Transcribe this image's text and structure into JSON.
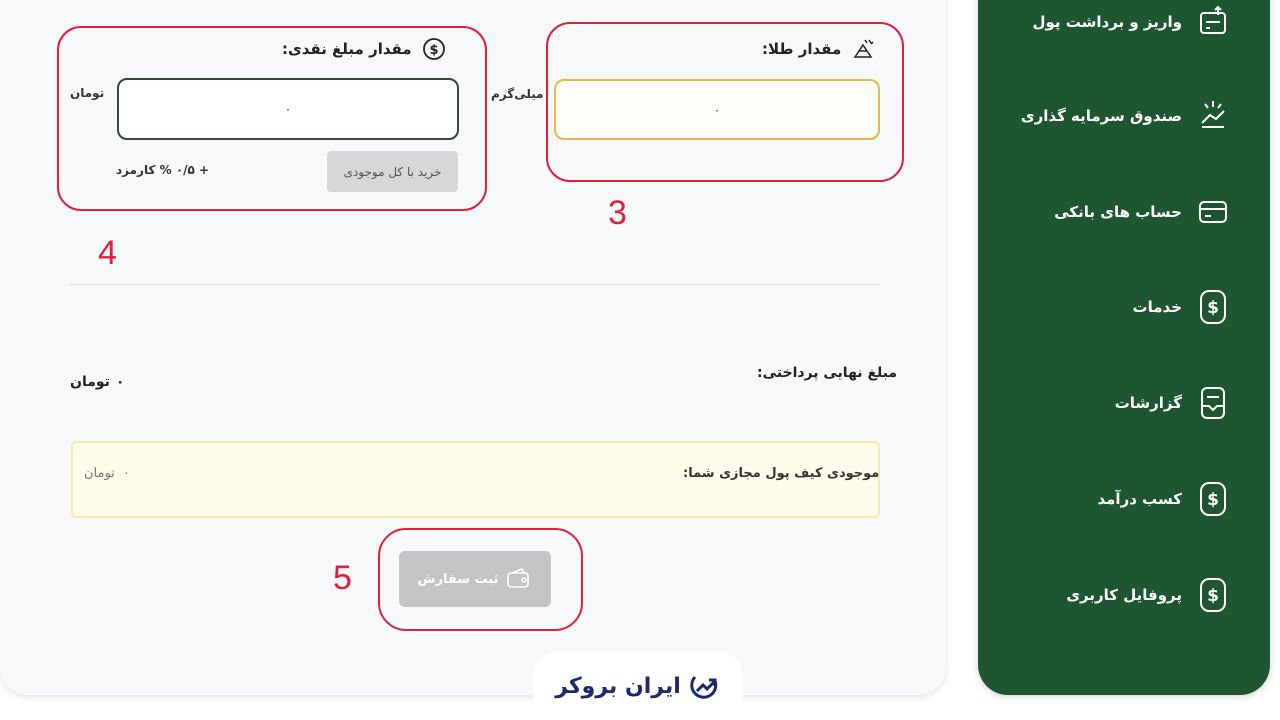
{
  "sidebar": {
    "items": [
      {
        "label": "واریز و برداشت پول",
        "icon": "wallet-transfer-icon"
      },
      {
        "label": "صندوق سرمایه گذاری",
        "icon": "investment-fund-icon"
      },
      {
        "label": "حساب های بانکی",
        "icon": "bank-card-icon"
      },
      {
        "label": "خدمات",
        "icon": "dollar-icon"
      },
      {
        "label": "گزارشات",
        "icon": "report-icon"
      },
      {
        "label": "کسب درآمد",
        "icon": "dollar-icon"
      },
      {
        "label": "پروفایل کاربری",
        "icon": "dollar-icon"
      }
    ]
  },
  "cash": {
    "title": "مقدار مبلغ نقدی:",
    "unit": "تومان",
    "value": "۰",
    "buy_all_label": "خرید با کل موجودی",
    "fee_label": "+ ۰/۵ % کارمزد"
  },
  "gold": {
    "title": "مقدار طلا:",
    "unit": "میلی‌گرم",
    "value": "۰"
  },
  "final": {
    "label": "مبلغ نهایی پرداختی:",
    "value": "۰",
    "unit": "تومان"
  },
  "wallet": {
    "label": "موجودی کیف پول مجازی شما:",
    "value": "۰",
    "unit": "تومان"
  },
  "submit": {
    "label": "ثبت سفارش"
  },
  "annotations": {
    "n3": "3",
    "n4": "4",
    "n5": "5"
  },
  "logo": {
    "text": "ایران بروکر"
  },
  "colors": {
    "sidebar": "#1e5631",
    "annotation": "#e0203a",
    "gold_border": "#e8b64a",
    "cash_border": "#2f4a3d"
  }
}
